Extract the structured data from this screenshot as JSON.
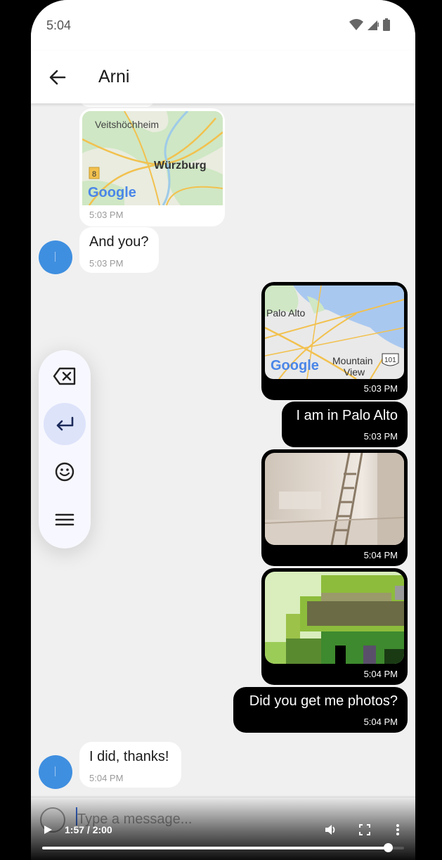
{
  "status_bar": {
    "time": "5:04"
  },
  "app_bar": {
    "title": "Arni"
  },
  "messages": [
    {
      "type": "map",
      "direction": "incoming",
      "map_labels": [
        "Veitshöchheim",
        "Würzburg",
        "8"
      ],
      "map_brand": "Google",
      "time": "5:03 PM"
    },
    {
      "type": "text",
      "direction": "incoming",
      "text": "And you?",
      "time": "5:03 PM"
    },
    {
      "type": "map",
      "direction": "outgoing",
      "map_labels": [
        "Palo Alto",
        "Mountain",
        "View",
        "101"
      ],
      "map_brand": "Google",
      "time": "5:03 PM"
    },
    {
      "type": "text",
      "direction": "outgoing",
      "text": "I am in Palo Alto",
      "time": "5:03 PM"
    },
    {
      "type": "image",
      "direction": "outgoing",
      "time": "5:04 PM"
    },
    {
      "type": "image",
      "direction": "outgoing",
      "time": "5:04 PM"
    },
    {
      "type": "text",
      "direction": "outgoing",
      "text": "Did you get me photos?",
      "time": "5:04 PM"
    },
    {
      "type": "text",
      "direction": "incoming",
      "text": "I did, thanks!",
      "time": "5:04 PM"
    }
  ],
  "composer": {
    "placeholder": "Type a message..."
  },
  "toolbar": {
    "buttons": [
      "backspace-icon",
      "enter-icon",
      "emoji-icon",
      "menu-icon"
    ],
    "active": "enter-icon"
  },
  "video_controls": {
    "time_display": "1:57 / 2:00",
    "progress": 0.955
  },
  "colors": {
    "avatar": "#3f8fe0",
    "outgoing_bubble": "#000000",
    "incoming_bubble": "#ffffff",
    "toolbar_active": "#dde3f9"
  }
}
